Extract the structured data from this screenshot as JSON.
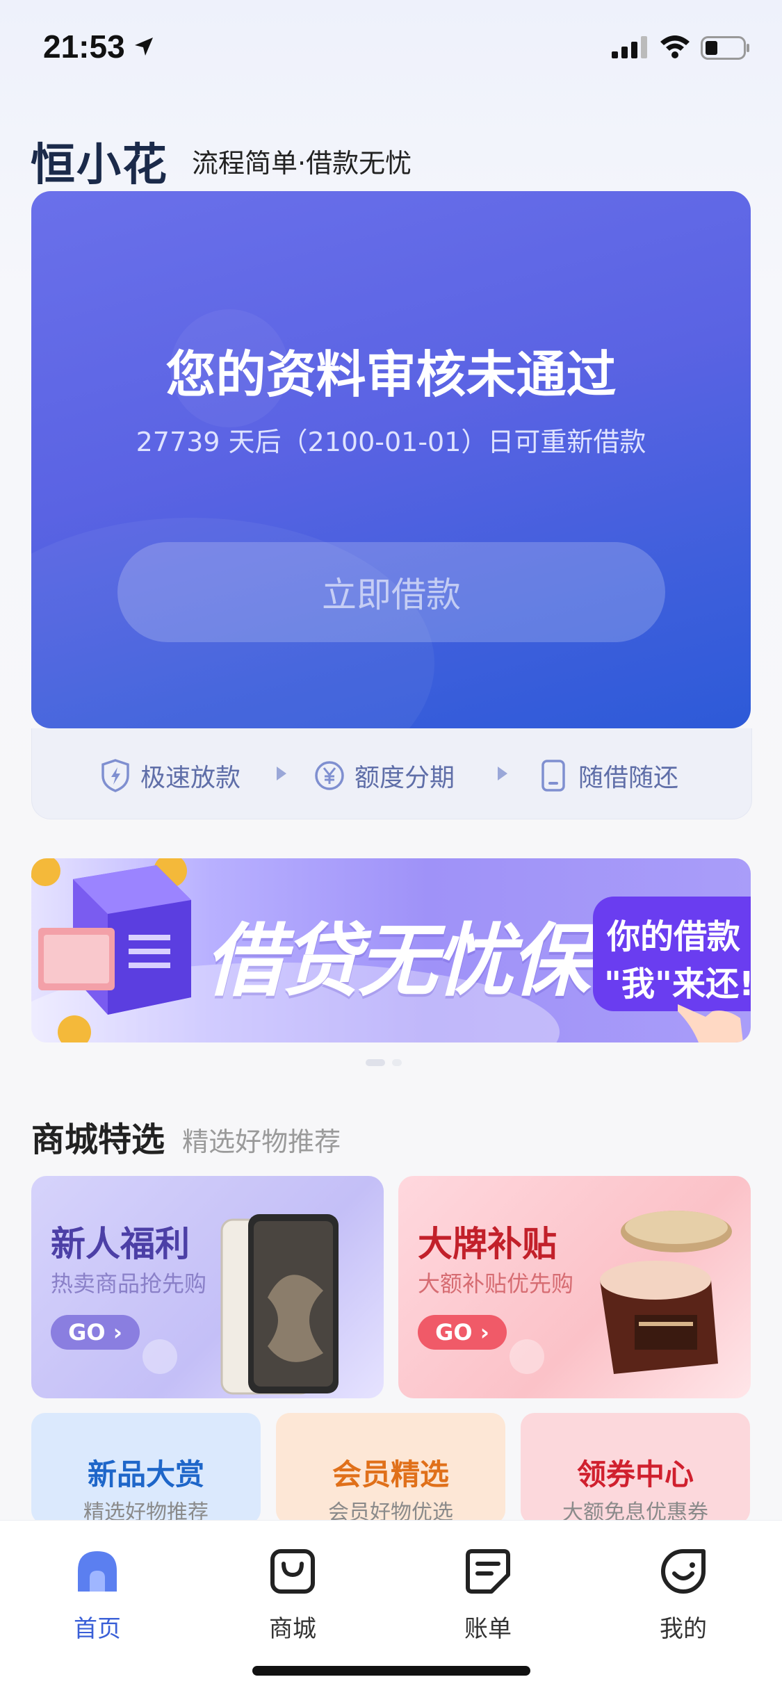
{
  "status_bar": {
    "time": "21:53"
  },
  "brand": {
    "logo": "恒小花",
    "slogan": "流程简单·借款无忧"
  },
  "hero": {
    "title": "您的资料审核未通过",
    "subtitle": "27739 天后（2100-01-01）日可重新借款",
    "button": "立即借款"
  },
  "features": [
    {
      "label": "极速放款",
      "icon": "shield-lightning-icon"
    },
    {
      "label": "额度分期",
      "icon": "yen-circle-icon"
    },
    {
      "label": "随借随还",
      "icon": "phone-icon"
    }
  ],
  "banner": {
    "title": "借贷无忧保",
    "tag_line1": "你的借款",
    "tag_line2": "\"我\"来还!",
    "pages": 2,
    "active_page": 1
  },
  "mall": {
    "title": "商城特选",
    "subtitle": "精选好物推荐",
    "promos": [
      {
        "title": "新人福利",
        "subtitle": "热卖商品抢先购",
        "button": "GO",
        "icon": "tablet-icon"
      },
      {
        "title": "大牌补贴",
        "subtitle": "大额补贴优先购",
        "button": "GO",
        "icon": "cream-jar-icon"
      }
    ],
    "tiles": [
      {
        "title": "新品大赏",
        "subtitle": "精选好物推荐"
      },
      {
        "title": "会员精选",
        "subtitle": "会员好物优选"
      },
      {
        "title": "领券中心",
        "subtitle": "大额免息优惠券"
      }
    ]
  },
  "tabbar": [
    {
      "label": "首页",
      "icon": "home-icon",
      "active": true
    },
    {
      "label": "商城",
      "icon": "shopping-bag-icon",
      "active": false
    },
    {
      "label": "账单",
      "icon": "bill-icon",
      "active": false
    },
    {
      "label": "我的",
      "icon": "profile-smile-icon",
      "active": false
    }
  ],
  "colors": {
    "hero_start": "#6a70ea",
    "hero_end": "#2d5ad8",
    "active_tab": "#3a5fd7",
    "feature_text": "#5f6ea8"
  }
}
